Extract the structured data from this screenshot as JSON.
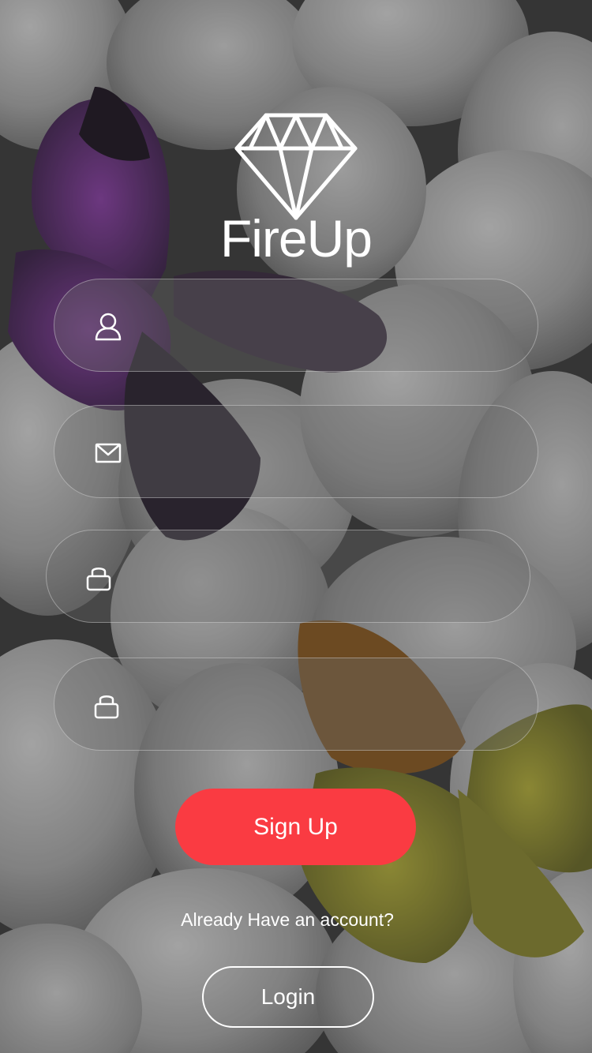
{
  "app": {
    "logo_text": "FireUp",
    "logo_icon": "diamond-icon"
  },
  "form": {
    "fields": [
      {
        "name": "username",
        "icon": "user-icon",
        "value": "",
        "placeholder": ""
      },
      {
        "name": "email",
        "icon": "mail-icon",
        "value": "",
        "placeholder": ""
      },
      {
        "name": "password",
        "icon": "lock-icon",
        "value": "",
        "placeholder": ""
      },
      {
        "name": "confirm_password",
        "icon": "lock-icon",
        "value": "",
        "placeholder": ""
      }
    ],
    "signup_label": "Sign Up",
    "account_prompt": "Already Have an account?",
    "login_label": "Login"
  },
  "colors": {
    "accent": "#fa3b42",
    "text": "#ffffff"
  }
}
